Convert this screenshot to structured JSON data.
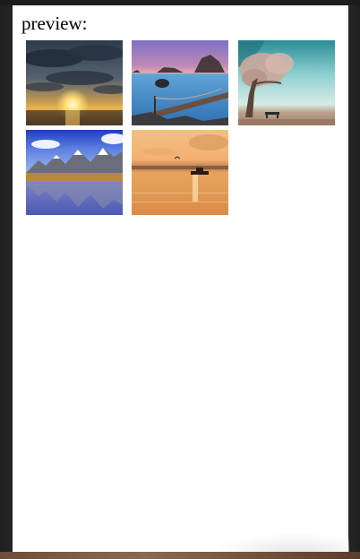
{
  "page": {
    "heading": "preview:"
  },
  "images": [
    {
      "name": "sunset-clouds",
      "icon": "sunset-over-sea-with-dark-clouds"
    },
    {
      "name": "purple-coast",
      "icon": "rocky-coast-with-wooden-pier"
    },
    {
      "name": "lone-tree",
      "icon": "tree-with-bench-on-beach"
    },
    {
      "name": "mountain-lake",
      "icon": "mountains-reflected-in-lake"
    },
    {
      "name": "golden-boat",
      "icon": "boat-on-golden-sea"
    }
  ]
}
